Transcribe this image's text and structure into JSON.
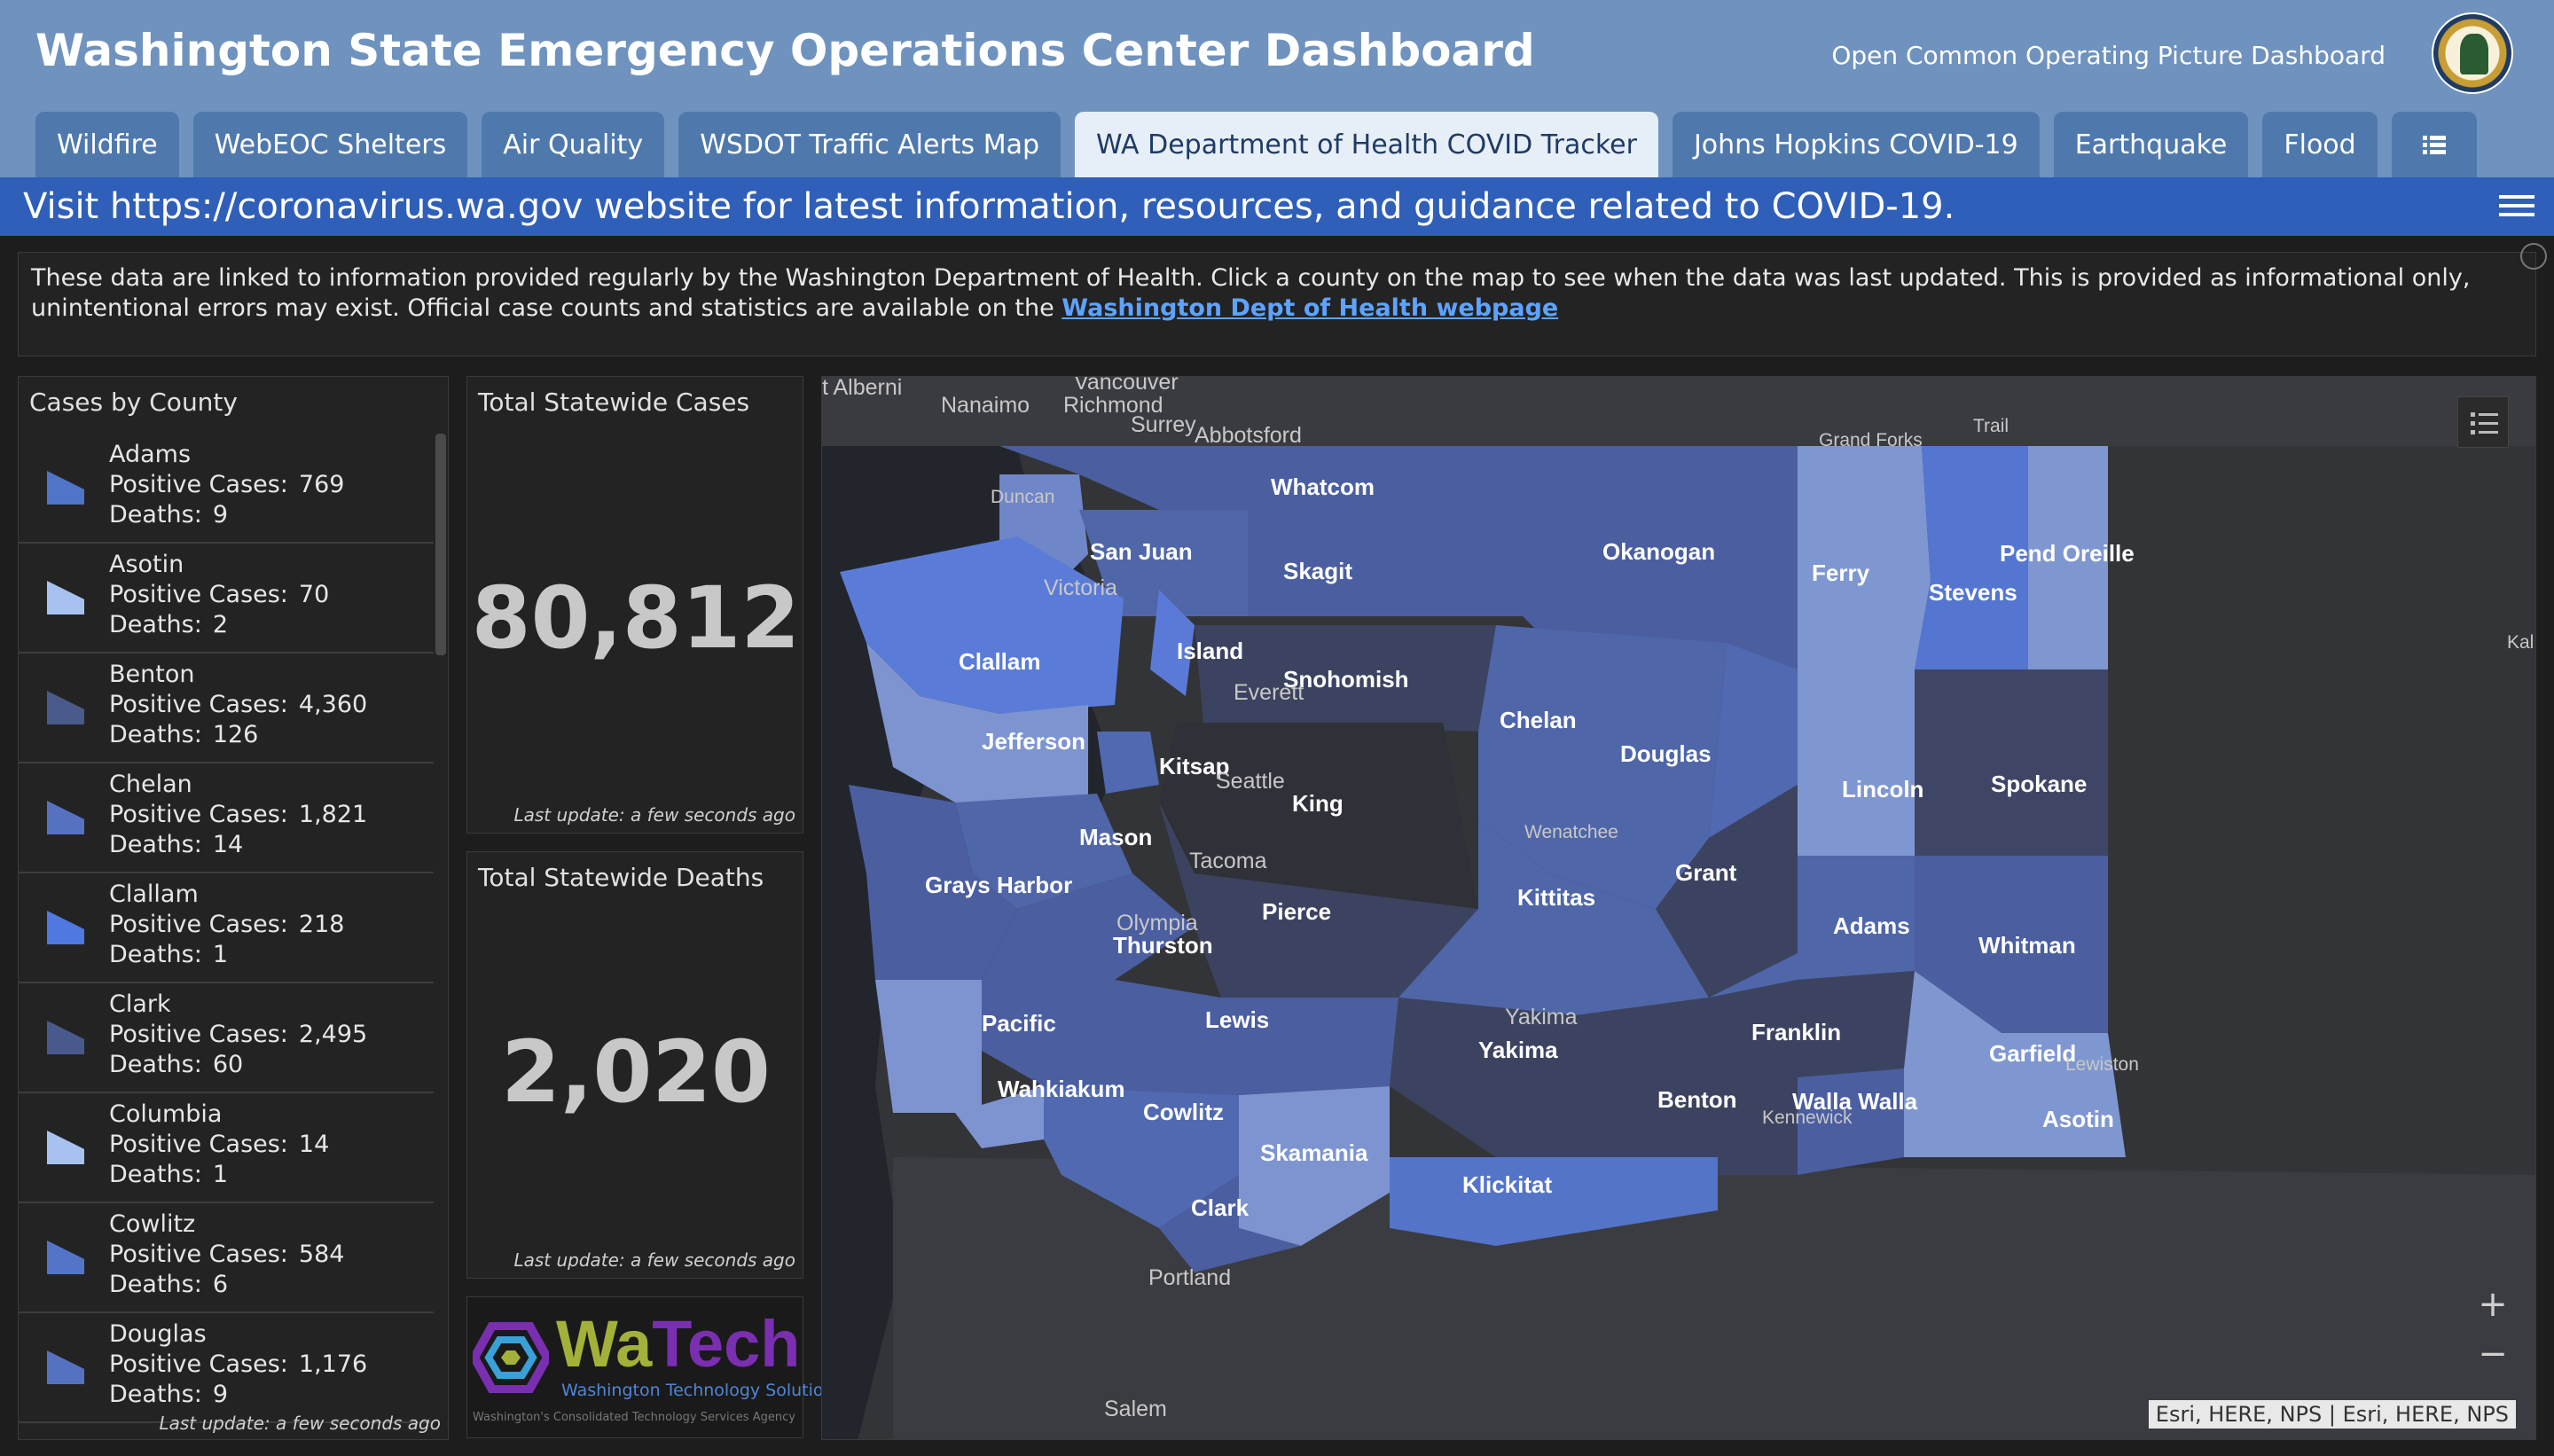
{
  "header": {
    "title": "Washington State Emergency Operations Center Dashboard",
    "subtitle": "Open Common Operating Picture Dashboard",
    "logo_icon": "state-seal-icon"
  },
  "tabs": [
    {
      "label": "Wildfire",
      "active": false
    },
    {
      "label": "WebEOC Shelters",
      "active": false
    },
    {
      "label": "Air Quality",
      "active": false
    },
    {
      "label": "WSDOT Traffic Alerts Map",
      "active": false
    },
    {
      "label": "WA Department of Health COVID Tracker",
      "active": true
    },
    {
      "label": "Johns Hopkins COVID-19",
      "active": false
    },
    {
      "label": "Earthquake",
      "active": false
    },
    {
      "label": "Flood",
      "active": false
    }
  ],
  "banner": {
    "text": "Visit https://coronavirus.wa.gov website for latest information, resources, and guidance related to COVID-19."
  },
  "info": {
    "text": "These data are linked to information provided regularly by the Washington Department of Health.  Click a county on the map to see when the data was last updated.  This is provided as informational only, unintentional errors may exist.  Official case counts and statistics are available on the ",
    "link": "Washington Dept of Health webpage"
  },
  "county_panel": {
    "title": "Cases by County",
    "cases_label": "Positive Cases:",
    "deaths_label": "Deaths:",
    "footer": "Last update: a few seconds ago",
    "items": [
      {
        "name": "Adams",
        "cases": "769",
        "deaths": "9",
        "color": "#4f74c8"
      },
      {
        "name": "Asotin",
        "cases": "70",
        "deaths": "2",
        "color": "#a8c2f0"
      },
      {
        "name": "Benton",
        "cases": "4,360",
        "deaths": "126",
        "color": "#4a5a8a"
      },
      {
        "name": "Chelan",
        "cases": "1,821",
        "deaths": "14",
        "color": "#5671c0"
      },
      {
        "name": "Clallam",
        "cases": "218",
        "deaths": "1",
        "color": "#4f78e0"
      },
      {
        "name": "Clark",
        "cases": "2,495",
        "deaths": "60",
        "color": "#485a8c"
      },
      {
        "name": "Columbia",
        "cases": "14",
        "deaths": "1",
        "color": "#a8c2f0"
      },
      {
        "name": "Cowlitz",
        "cases": "584",
        "deaths": "6",
        "color": "#5474c8"
      },
      {
        "name": "Douglas",
        "cases": "1,176",
        "deaths": "9",
        "color": "#5671c0"
      }
    ]
  },
  "stats": {
    "cases": {
      "title": "Total Statewide Cases",
      "value": "80,812",
      "footer": "Last update: a few seconds ago"
    },
    "deaths": {
      "title": "Total Statewide Deaths",
      "value": "2,020",
      "footer": "Last update: a few seconds ago"
    }
  },
  "watech": {
    "logo_wa": "Wa",
    "logo_tech": "Tech",
    "tagline": "Washington Technology Solutions",
    "small": "Washington's Consolidated Technology Services Agency"
  },
  "map": {
    "attribution": "Esri, HERE, NPS | Esri, HERE, NPS",
    "zoom_in": "+",
    "zoom_out": "−",
    "county_labels": [
      "Whatcom",
      "San Juan",
      "Skagit",
      "Okanogan",
      "Ferry",
      "Stevens",
      "Pend Oreille",
      "Clallam",
      "Island",
      "Snohomish",
      "Chelan",
      "Jefferson",
      "Kitsap",
      "King",
      "Douglas",
      "Lincoln",
      "Spokane",
      "Mason",
      "Grays Harbor",
      "Pierce",
      "Kittitas",
      "Grant",
      "Thurston",
      "Adams",
      "Whitman",
      "Pacific",
      "Lewis",
      "Franklin",
      "Garfield",
      "Wahkiakum",
      "Cowlitz",
      "Yakima",
      "Benton",
      "Walla Walla",
      "Asotin",
      "Skamania",
      "Klickitat",
      "Clark"
    ],
    "place_labels": [
      "t Alberni",
      "Nanaimo",
      "Vancouver",
      "Richmond",
      "Surrey",
      "Abbotsford",
      "Grand Forks",
      "Trail",
      "Duncan",
      "Victoria",
      "Everett",
      "Seattle",
      "Tacoma",
      "Wenatchee",
      "Olympia",
      "Yakima",
      "Kennewick",
      "Lewiston",
      "Portland",
      "Salem",
      "Kal"
    ]
  }
}
